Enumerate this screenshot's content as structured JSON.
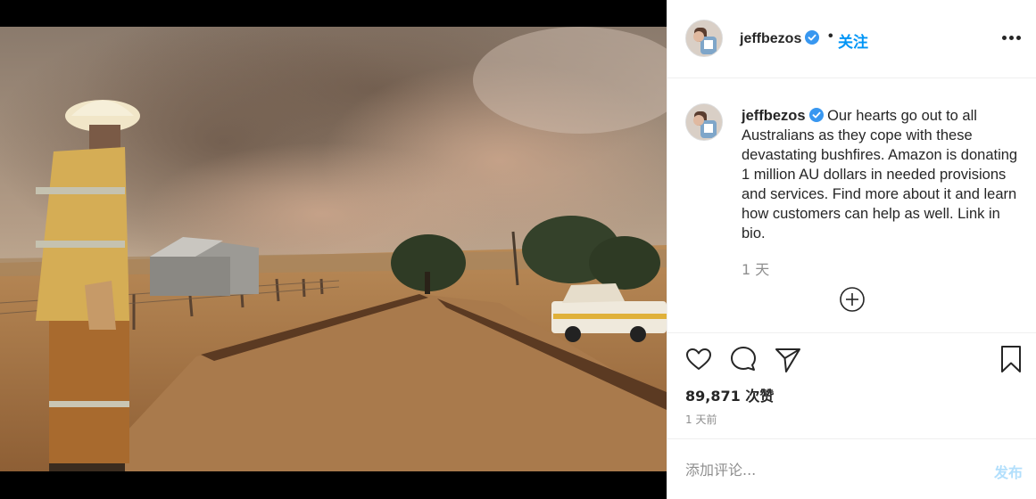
{
  "post": {
    "username": "jeffbezos",
    "verified": true,
    "separator": "•",
    "follow_label": "关注",
    "caption_username": "jeffbezos",
    "caption_text": " Our hearts go out to all Australians as they cope with these devastating bushfires. Amazon is donating 1 million AU dollars in needed provisions and services. Find more about it and learn how customers can help as well. Link in bio.",
    "caption_time": "1 天",
    "likes": "89,871 次赞",
    "date": "1 天前"
  },
  "comment": {
    "placeholder": "添加评论...",
    "post_label": "发布"
  },
  "colors": {
    "accent": "#0095f6",
    "post_disabled": "#b2dffc",
    "verified": "#3897f0"
  },
  "icons": [
    "more-options-icon",
    "verified-badge-icon",
    "load-more-comments-icon",
    "heart-icon",
    "comment-icon",
    "share-icon",
    "bookmark-icon"
  ]
}
